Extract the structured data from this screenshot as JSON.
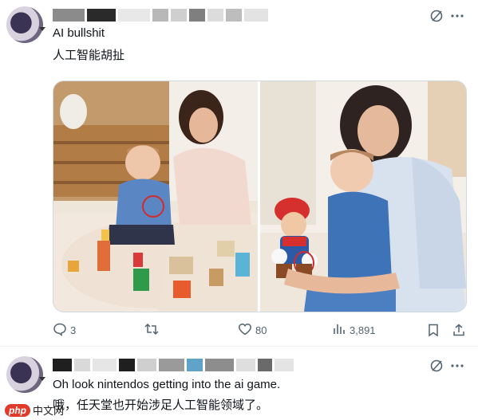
{
  "tweet1": {
    "text_en": "AI bullshit",
    "text_zh": "人工智能胡扯",
    "actions": {
      "replies": "3",
      "retweets": "",
      "likes": "80",
      "views": "3,891"
    }
  },
  "tweet2": {
    "text_en": "Oh look nintendos getting into the ai game.",
    "text_zh": "哦，任天堂也开始涉足人工智能领域了。"
  },
  "watermark": {
    "brand": "php",
    "site": "中文网"
  },
  "icons": {
    "grok": "slash-circle-icon",
    "more": "more-dots-icon",
    "reply": "comment-icon",
    "retweet": "retweet-icon",
    "like": "heart-icon",
    "views": "bar-chart-icon",
    "bookmark": "bookmark-icon",
    "share": "share-icon"
  },
  "colors": {
    "text": "#0f1419",
    "muted": "#536471",
    "border": "#cfd9de"
  }
}
